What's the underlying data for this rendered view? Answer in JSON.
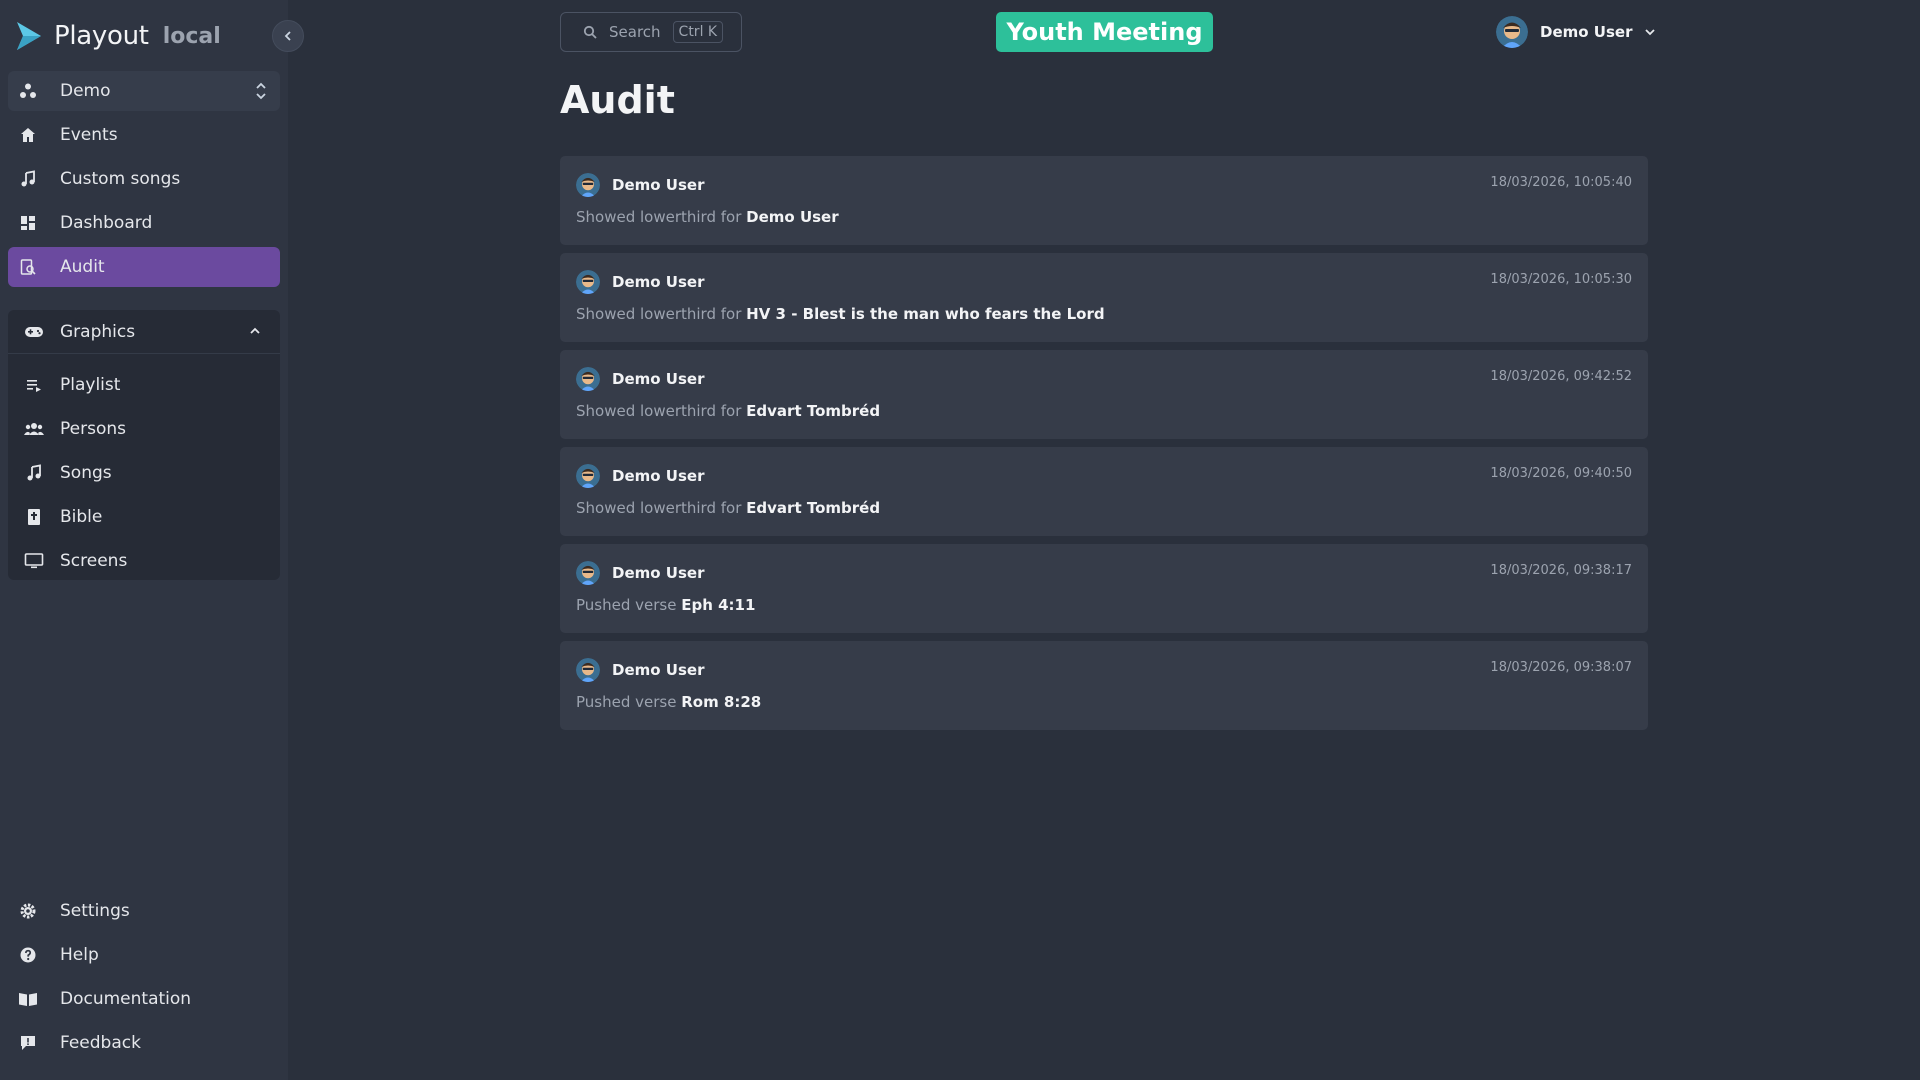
{
  "brand": {
    "name": "Playout",
    "env": "local",
    "accent": "#5cc8e6"
  },
  "workspace": {
    "label": "Demo"
  },
  "nav": {
    "events": "Events",
    "custom_songs": "Custom songs",
    "dashboard": "Dashboard",
    "audit": "Audit"
  },
  "graphics": {
    "label": "Graphics",
    "items": {
      "playlist": "Playlist",
      "persons": "Persons",
      "songs": "Songs",
      "bible": "Bible",
      "screens": "Screens"
    }
  },
  "footer_nav": {
    "settings": "Settings",
    "help": "Help",
    "documentation": "Documentation",
    "feedback": "Feedback"
  },
  "header": {
    "search_label": "Search",
    "search_shortcut": "Ctrl K",
    "event_name": "Youth Meeting",
    "event_color": "#2dc09a",
    "user_name": "Demo User"
  },
  "page": {
    "title": "Audit"
  },
  "audit": [
    {
      "user": "Demo User",
      "time": "18/03/2026, 10:05:40",
      "action": "Showed lowerthird for",
      "target": "Demo User"
    },
    {
      "user": "Demo User",
      "time": "18/03/2026, 10:05:30",
      "action": "Showed lowerthird for",
      "target": "HV 3 - Blest is the man who fears the Lord"
    },
    {
      "user": "Demo User",
      "time": "18/03/2026, 09:42:52",
      "action": "Showed lowerthird for",
      "target": "Edvart Tombréd"
    },
    {
      "user": "Demo User",
      "time": "18/03/2026, 09:40:50",
      "action": "Showed lowerthird for",
      "target": "Edvart Tombréd"
    },
    {
      "user": "Demo User",
      "time": "18/03/2026, 09:38:17",
      "action": "Pushed verse",
      "target": "Eph 4:11"
    },
    {
      "user": "Demo User",
      "time": "18/03/2026, 09:38:07",
      "action": "Pushed verse",
      "target": "Rom 8:28"
    }
  ]
}
